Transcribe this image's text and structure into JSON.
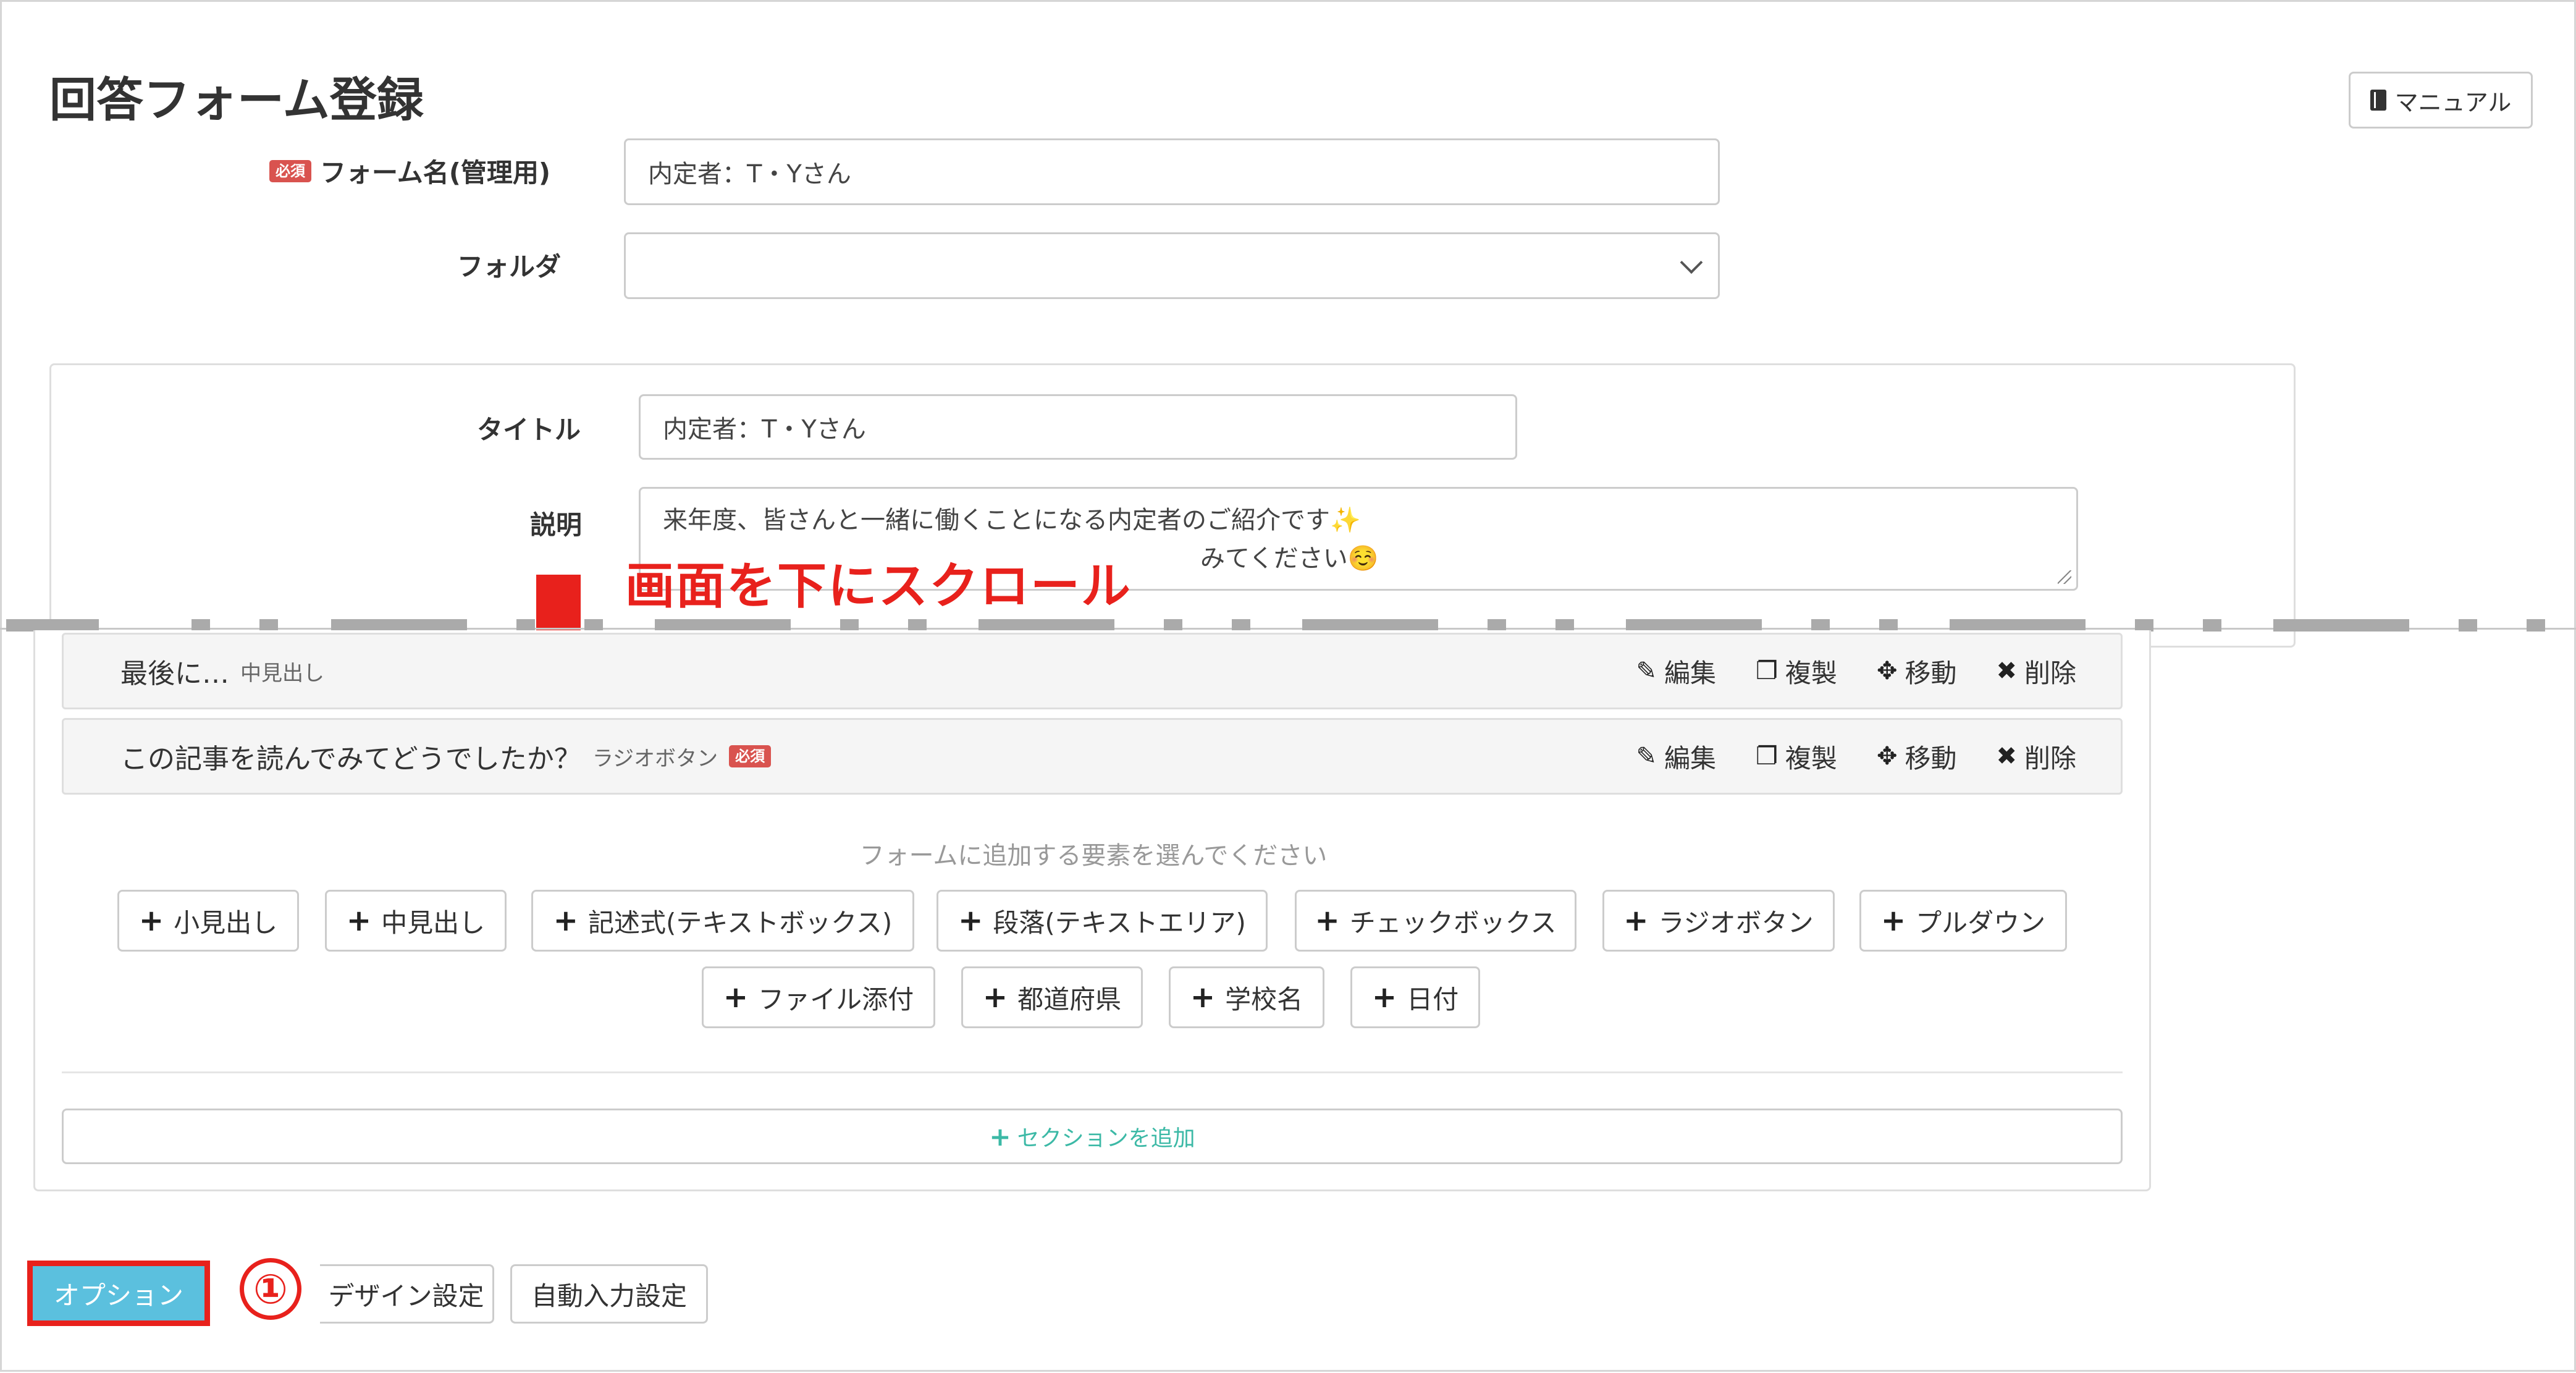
{
  "header": {
    "title": "回答フォーム登録",
    "manual_label": "マニュアル"
  },
  "form": {
    "required_badge": "必須",
    "form_name_label": "フォーム名(管理用)",
    "form_name_value": "内定者：T・Yさん",
    "folder_label": "フォルダ",
    "folder_value": ""
  },
  "section": {
    "title_label": "タイトル",
    "title_value": "内定者：T・Yさん",
    "description_label": "説明",
    "description_line1": "来年度、皆さんと一緒に働くことになる内定者のご紹介です✨",
    "description_line2": "みてください☺️"
  },
  "annotation": {
    "scroll_text": "画面を下にスクロール",
    "step_number": "①"
  },
  "items": [
    {
      "title": "最後に…",
      "type": "中見出し",
      "required": false
    },
    {
      "title": "この記事を読んでみてどうでしたか？",
      "type": "ラジオボタン",
      "required": true
    }
  ],
  "item_actions": {
    "edit": "編集",
    "duplicate": "複製",
    "move": "移動",
    "delete": "削除"
  },
  "add_elements": {
    "hint": "フォームに追加する要素を選んでください",
    "row1": [
      "小見出し",
      "中見出し",
      "記述式(テキストボックス)",
      "段落(テキストエリア)",
      "チェックボックス",
      "ラジオボタン",
      "プルダウン"
    ],
    "row2": [
      "ファイル添付",
      "都道府県",
      "学校名",
      "日付"
    ]
  },
  "add_section_label": "セクションを追加",
  "footer_tabs": {
    "option": "オプション",
    "design": "デザイン設定",
    "auto_input": "自動入力設定"
  },
  "colors": {
    "required_badge": "#d9534f",
    "annotation_red": "#e8211c",
    "option_button": "#5bc0de",
    "add_section": "#3cb9a6"
  }
}
